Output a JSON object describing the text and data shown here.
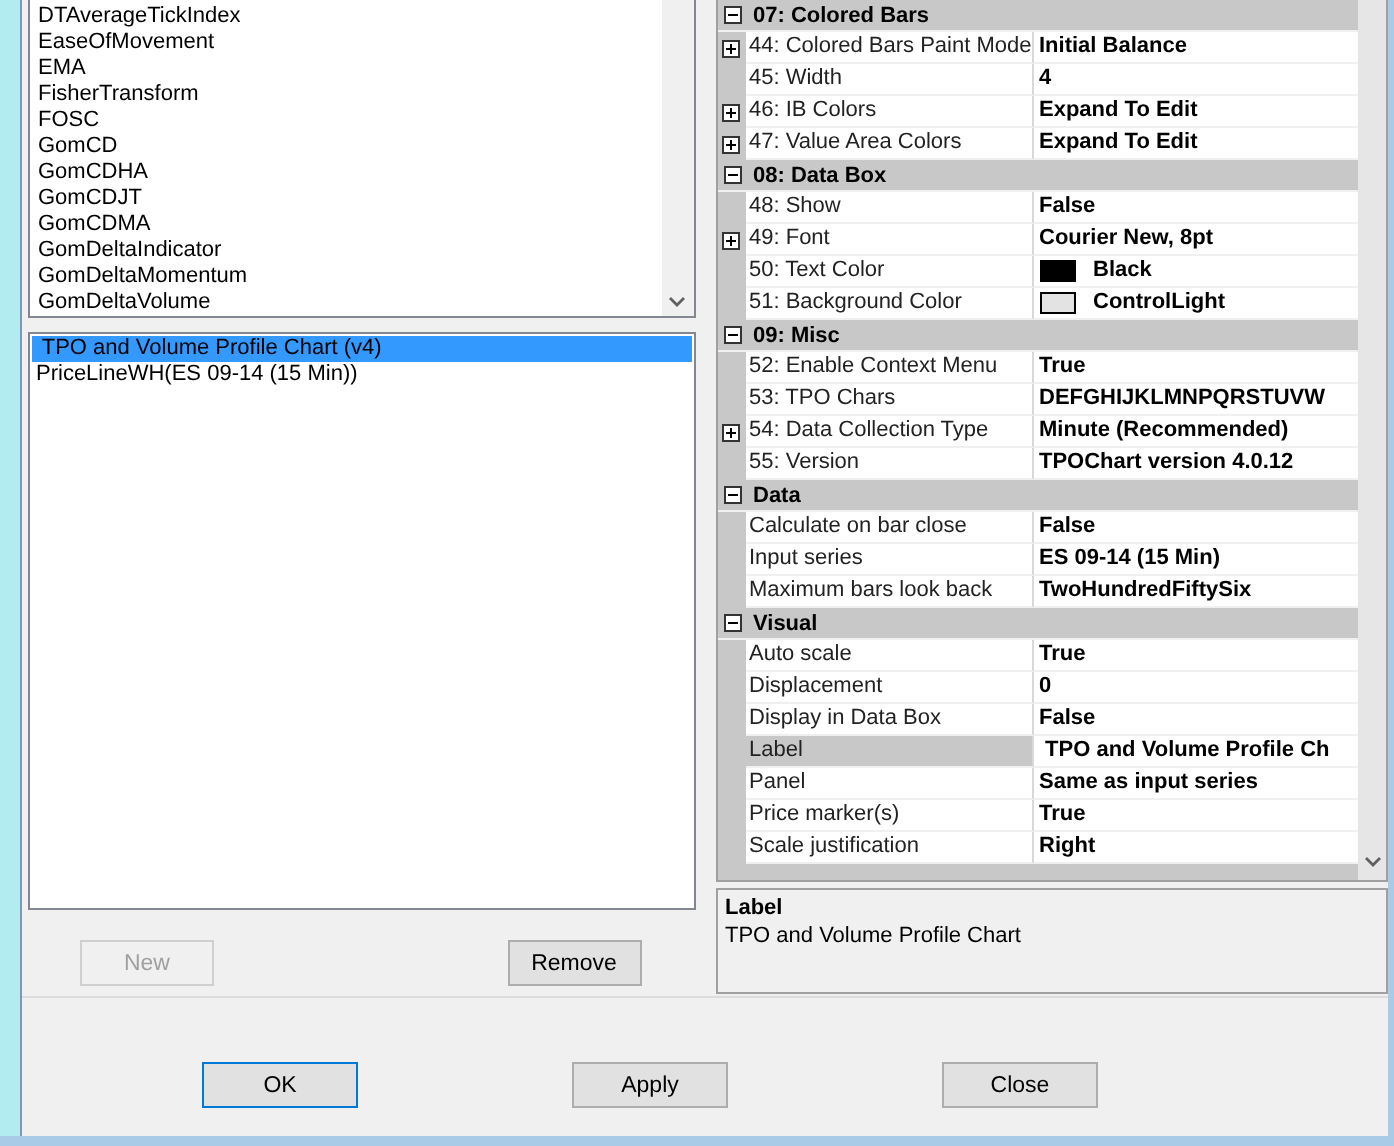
{
  "indicator_list": {
    "items": [
      "DTAverageTickIndex",
      "EaseOfMovement",
      "EMA",
      "FisherTransform",
      "FOSC",
      "GomCD",
      "GomCDHA",
      "GomCDJT",
      "GomCDMA",
      "GomDeltaIndicator",
      "GomDeltaMomentum",
      "GomDeltaVolume"
    ]
  },
  "applied_list": {
    "items": [
      {
        "label": " TPO and Volume Profile Chart (v4)",
        "selected": true
      },
      {
        "label": "PriceLineWH(ES 09-14 (15 Min))",
        "selected": false
      }
    ]
  },
  "list_buttons": [
    {
      "label": "New",
      "disabled": true
    },
    {
      "label": "Remove",
      "disabled": false
    }
  ],
  "property_grid": {
    "groups": [
      {
        "title": "07: Colored Bars",
        "expanded": true,
        "rows": [
          {
            "name": "44: Colored Bars Paint Mode",
            "value": "Initial Balance",
            "kind": "expandable",
            "selected": false
          },
          {
            "name": "45: Width",
            "value": "4",
            "kind": "text",
            "selected": false
          },
          {
            "name": "46: IB Colors",
            "value": "Expand To Edit",
            "kind": "expandable",
            "selected": false
          },
          {
            "name": "47: Value Area Colors",
            "value": "Expand To Edit",
            "kind": "expandable",
            "selected": false
          }
        ]
      },
      {
        "title": "08: Data Box",
        "expanded": true,
        "rows": [
          {
            "name": "48: Show",
            "value": "False",
            "kind": "text",
            "selected": false
          },
          {
            "name": "49: Font",
            "value": "Courier New, 8pt",
            "kind": "expandable",
            "selected": false
          },
          {
            "name": "50: Text Color",
            "value": "Black",
            "kind": "color",
            "color": "#000000",
            "selected": false
          },
          {
            "name": "51: Background Color",
            "value": "ControlLight",
            "kind": "color",
            "color": "#e3e3e3",
            "selected": false
          }
        ]
      },
      {
        "title": "09: Misc",
        "expanded": true,
        "rows": [
          {
            "name": "52: Enable Context Menu",
            "value": "True",
            "kind": "text",
            "selected": false
          },
          {
            "name": "53: TPO Chars",
            "value": "DEFGHIJKLMNPQRSTUVW",
            "kind": "text",
            "selected": false
          },
          {
            "name": "54: Data Collection Type",
            "value": "Minute (Recommended)",
            "kind": "expandable",
            "selected": false
          },
          {
            "name": "55: Version",
            "value": "TPOChart version 4.0.12",
            "kind": "text",
            "selected": false
          }
        ]
      },
      {
        "title": "Data",
        "expanded": true,
        "rows": [
          {
            "name": "Calculate on bar close",
            "value": "False",
            "kind": "text",
            "selected": false
          },
          {
            "name": "Input series",
            "value": "ES 09-14 (15 Min)",
            "kind": "text",
            "selected": false
          },
          {
            "name": "Maximum bars look back",
            "value": "TwoHundredFiftySix",
            "kind": "text",
            "selected": false
          }
        ]
      },
      {
        "title": "Visual",
        "expanded": true,
        "rows": [
          {
            "name": "Auto scale",
            "value": "True",
            "kind": "text",
            "selected": false
          },
          {
            "name": "Displacement",
            "value": "0",
            "kind": "text",
            "selected": false
          },
          {
            "name": "Display in Data Box",
            "value": "False",
            "kind": "text",
            "selected": false
          },
          {
            "name": "Label",
            "value": " TPO and Volume Profile Ch",
            "kind": "text",
            "selected": true
          },
          {
            "name": "Panel",
            "value": "Same as input series",
            "kind": "text",
            "selected": false
          },
          {
            "name": "Price marker(s)",
            "value": "True",
            "kind": "text",
            "selected": false
          },
          {
            "name": "Scale justification",
            "value": "Right",
            "kind": "text",
            "selected": false
          }
        ]
      }
    ]
  },
  "description": {
    "title": "Label",
    "text": "TPO and Volume Profile Chart"
  },
  "dialog_buttons": [
    {
      "label": "OK",
      "default": true
    },
    {
      "label": "Apply",
      "default": false
    },
    {
      "label": "Close",
      "default": false
    }
  ]
}
